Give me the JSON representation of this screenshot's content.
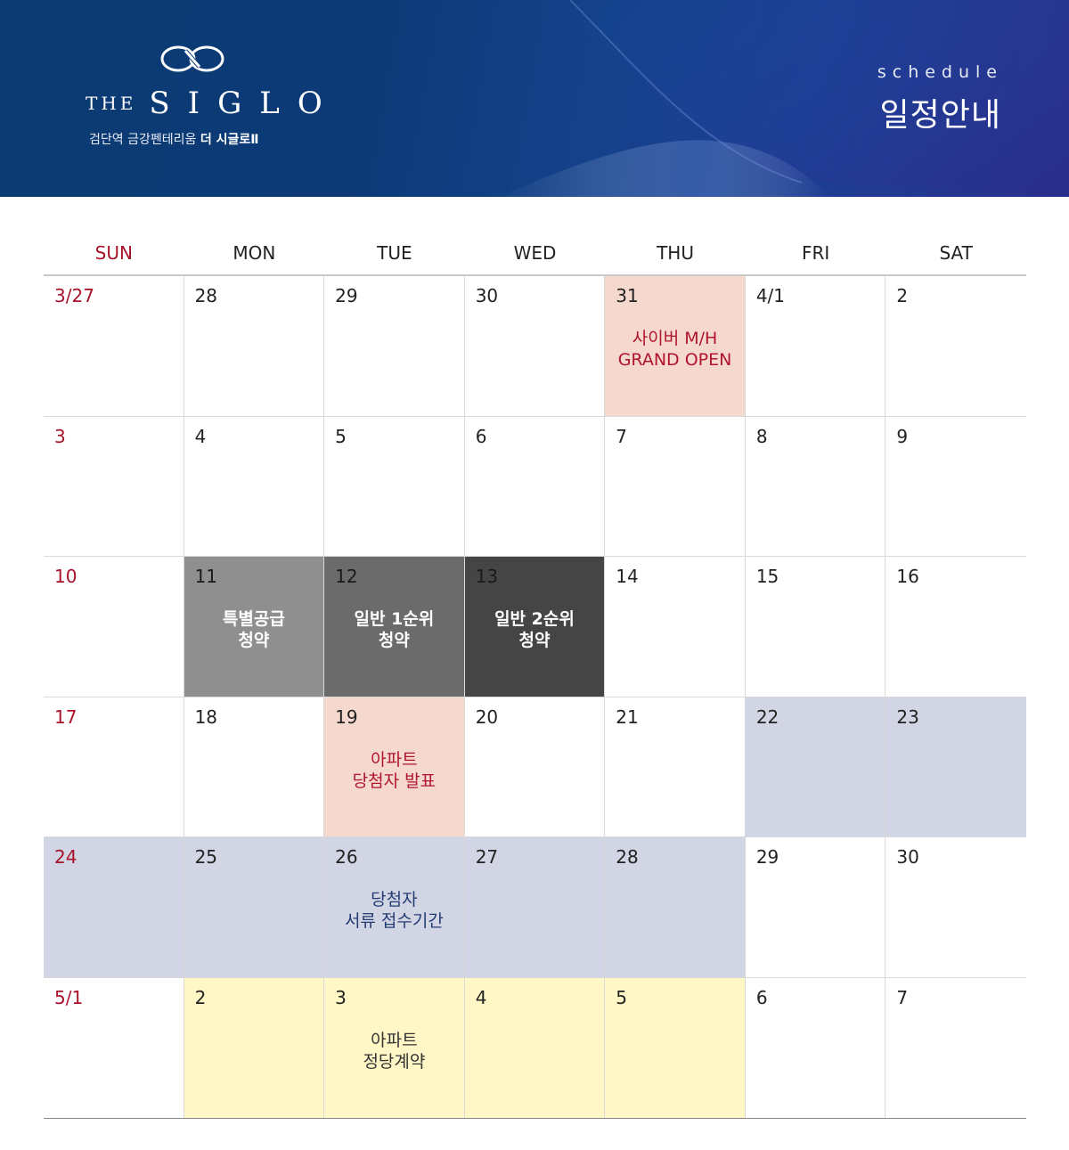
{
  "header": {
    "brand_the": "THE",
    "brand_name": "SIGLO",
    "brand_subtitle": "검단역 금강펜테리움",
    "brand_subtitle_bold": "더 시글로Ⅱ",
    "schedule_en": "schedule",
    "schedule_ko": "일정안내"
  },
  "colors": {
    "header_bg": "#0d3a77",
    "sunday_red": "#a8122a",
    "peach": "#f5d9ce",
    "gray_light": "#8f8f8f",
    "gray_mid": "#6b6b6b",
    "gray_dark": "#454545",
    "lavender": "#d2d5e3",
    "yellow": "#fff7c6"
  },
  "weekdays": [
    "SUN",
    "MON",
    "TUE",
    "WED",
    "THU",
    "FRI",
    "SAT"
  ],
  "weeks": [
    [
      {
        "day": "3/27",
        "style": "",
        "event": ""
      },
      {
        "day": "28",
        "style": "",
        "event": ""
      },
      {
        "day": "29",
        "style": "",
        "event": ""
      },
      {
        "day": "30",
        "style": "",
        "event": ""
      },
      {
        "day": "31",
        "style": "peach",
        "event": "사이버 M/H\nGRAND OPEN"
      },
      {
        "day": "4/1",
        "style": "",
        "event": ""
      },
      {
        "day": "2",
        "style": "",
        "event": ""
      }
    ],
    [
      {
        "day": "3",
        "style": "",
        "event": ""
      },
      {
        "day": "4",
        "style": "",
        "event": ""
      },
      {
        "day": "5",
        "style": "",
        "event": ""
      },
      {
        "day": "6",
        "style": "",
        "event": ""
      },
      {
        "day": "7",
        "style": "",
        "event": ""
      },
      {
        "day": "8",
        "style": "",
        "event": ""
      },
      {
        "day": "9",
        "style": "",
        "event": ""
      }
    ],
    [
      {
        "day": "10",
        "style": "",
        "event": ""
      },
      {
        "day": "11",
        "style": "g1",
        "event": "특별공급\n청약"
      },
      {
        "day": "12",
        "style": "g2",
        "event": "일반 1순위\n청약"
      },
      {
        "day": "13",
        "style": "g3",
        "event": "일반 2순위\n청약"
      },
      {
        "day": "14",
        "style": "",
        "event": ""
      },
      {
        "day": "15",
        "style": "",
        "event": ""
      },
      {
        "day": "16",
        "style": "",
        "event": ""
      }
    ],
    [
      {
        "day": "17",
        "style": "",
        "event": ""
      },
      {
        "day": "18",
        "style": "",
        "event": ""
      },
      {
        "day": "19",
        "style": "peach",
        "event": "아파트\n당첨자 발표"
      },
      {
        "day": "20",
        "style": "",
        "event": ""
      },
      {
        "day": "21",
        "style": "",
        "event": ""
      },
      {
        "day": "22",
        "style": "lav",
        "event": ""
      },
      {
        "day": "23",
        "style": "lav",
        "event": ""
      }
    ],
    [
      {
        "day": "24",
        "style": "lav",
        "event": ""
      },
      {
        "day": "25",
        "style": "lav",
        "event": ""
      },
      {
        "day": "26",
        "style": "lav",
        "event": "당첨자\n서류 접수기간"
      },
      {
        "day": "27",
        "style": "lav",
        "event": ""
      },
      {
        "day": "28",
        "style": "lav",
        "event": ""
      },
      {
        "day": "29",
        "style": "",
        "event": ""
      },
      {
        "day": "30",
        "style": "",
        "event": ""
      }
    ],
    [
      {
        "day": "5/1",
        "style": "",
        "event": ""
      },
      {
        "day": "2",
        "style": "yel",
        "event": ""
      },
      {
        "day": "3",
        "style": "yel",
        "event": "아파트\n정당계약"
      },
      {
        "day": "4",
        "style": "yel",
        "event": ""
      },
      {
        "day": "5",
        "style": "yel",
        "event": ""
      },
      {
        "day": "6",
        "style": "",
        "event": ""
      },
      {
        "day": "7",
        "style": "",
        "event": ""
      }
    ]
  ]
}
